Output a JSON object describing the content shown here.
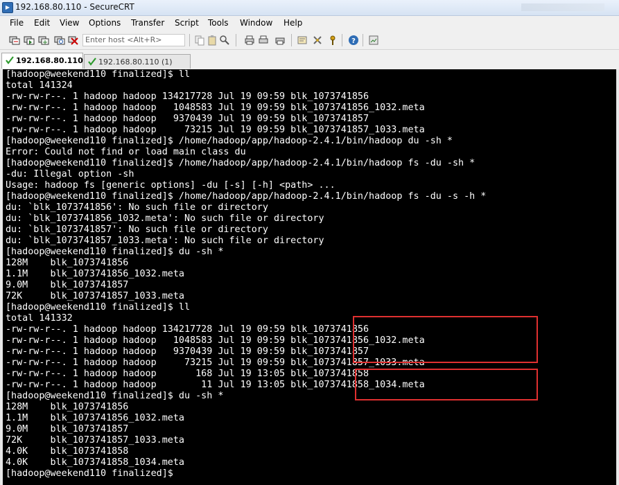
{
  "window": {
    "title": "192.168.80.110 - SecureCRT"
  },
  "menu": {
    "items": [
      "File",
      "Edit",
      "View",
      "Options",
      "Transfer",
      "Script",
      "Tools",
      "Window",
      "Help"
    ]
  },
  "toolbar": {
    "host_placeholder": "Enter host <Alt+R>"
  },
  "tabs": [
    {
      "label": "192.168.80.110",
      "active": true
    },
    {
      "label": "192.168.80.110 (1)",
      "active": false
    }
  ],
  "terminal": {
    "lines": [
      "[hadoop@weekend110 finalized]$ ll",
      "total 141324",
      "-rw-rw-r--. 1 hadoop hadoop 134217728 Jul 19 09:59 blk_1073741856",
      "-rw-rw-r--. 1 hadoop hadoop   1048583 Jul 19 09:59 blk_1073741856_1032.meta",
      "-rw-rw-r--. 1 hadoop hadoop   9370439 Jul 19 09:59 blk_1073741857",
      "-rw-rw-r--. 1 hadoop hadoop     73215 Jul 19 09:59 blk_1073741857_1033.meta",
      "[hadoop@weekend110 finalized]$ /home/hadoop/app/hadoop-2.4.1/bin/hadoop du -sh *",
      "Error: Could not find or load main class du",
      "[hadoop@weekend110 finalized]$ /home/hadoop/app/hadoop-2.4.1/bin/hadoop fs -du -sh *",
      "-du: Illegal option -sh",
      "Usage: hadoop fs [generic options] -du [-s] [-h] <path> ...",
      "[hadoop@weekend110 finalized]$ /home/hadoop/app/hadoop-2.4.1/bin/hadoop fs -du -s -h *",
      "du: `blk_1073741856': No such file or directory",
      "du: `blk_1073741856_1032.meta': No such file or directory",
      "du: `blk_1073741857': No such file or directory",
      "du: `blk_1073741857_1033.meta': No such file or directory",
      "[hadoop@weekend110 finalized]$ du -sh *",
      "128M    blk_1073741856",
      "1.1M    blk_1073741856_1032.meta",
      "9.0M    blk_1073741857",
      "72K     blk_1073741857_1033.meta",
      "[hadoop@weekend110 finalized]$ ll",
      "total 141332",
      "-rw-rw-r--. 1 hadoop hadoop 134217728 Jul 19 09:59 blk_1073741856",
      "-rw-rw-r--. 1 hadoop hadoop   1048583 Jul 19 09:59 blk_1073741856_1032.meta",
      "-rw-rw-r--. 1 hadoop hadoop   9370439 Jul 19 09:59 blk_1073741857",
      "-rw-rw-r--. 1 hadoop hadoop     73215 Jul 19 09:59 blk_1073741857_1033.meta",
      "-rw-rw-r--. 1 hadoop hadoop       168 Jul 19 13:05 blk_1073741858",
      "-rw-rw-r--. 1 hadoop hadoop        11 Jul 19 13:05 blk_1073741858_1034.meta",
      "[hadoop@weekend110 finalized]$ du -sh *",
      "128M    blk_1073741856",
      "1.1M    blk_1073741856_1032.meta",
      "9.0M    blk_1073741857",
      "72K     blk_1073741857_1033.meta",
      "4.0K    blk_1073741858",
      "4.0K    blk_1073741858_1034.meta",
      "[hadoop@weekend110 finalized]$ "
    ]
  },
  "colors": {
    "terminal_bg": "#000000",
    "terminal_fg": "#ffffff",
    "highlight": "#e03030"
  }
}
